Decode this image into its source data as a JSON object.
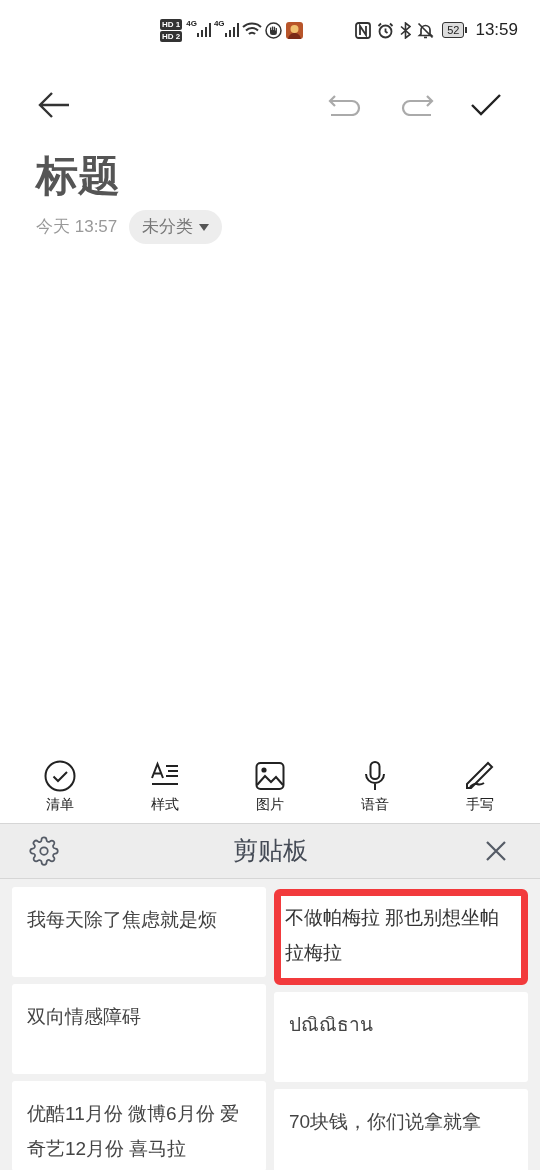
{
  "status_bar": {
    "sim_badges": [
      "HD 1",
      "HD 2"
    ],
    "networks": [
      "4G",
      "4G"
    ],
    "battery": "52",
    "time": "13:59"
  },
  "note": {
    "title": "标题",
    "date": "今天 13:57",
    "category": "未分类"
  },
  "toolbar": [
    {
      "kind": "checklist",
      "label": "清单"
    },
    {
      "kind": "style",
      "label": "样式"
    },
    {
      "kind": "image",
      "label": "图片"
    },
    {
      "kind": "voice",
      "label": "语音"
    },
    {
      "kind": "handwriting",
      "label": "手写"
    }
  ],
  "clipboard": {
    "title": "剪贴板",
    "columns": [
      [
        {
          "text": "我每天除了焦虑就是烦",
          "highlighted": false
        },
        {
          "text": "双向情感障碍",
          "highlighted": false
        },
        {
          "text": "优酷11月份 微博6月份 爱奇艺12月份 喜马拉",
          "highlighted": false
        }
      ],
      [
        {
          "text": "不做帕梅拉 那也别想坐帕拉梅拉",
          "highlighted": true
        },
        {
          "text": "ปณิณิธาน",
          "highlighted": false
        },
        {
          "text": "70块钱，你们说拿就拿",
          "highlighted": false
        }
      ]
    ]
  }
}
